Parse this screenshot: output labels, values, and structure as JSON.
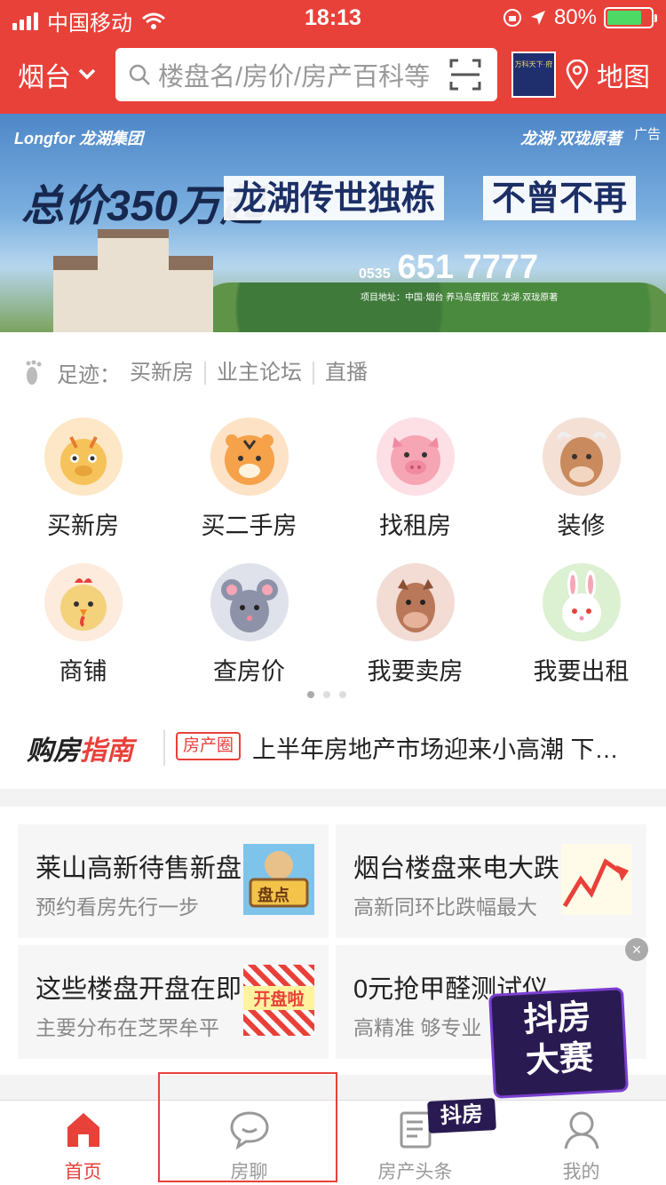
{
  "status_bar": {
    "carrier": "中国移动",
    "time": "18:13",
    "battery": "80%",
    "battery_level": 0.8
  },
  "header": {
    "city": "烟台",
    "search_placeholder": "楼盘名/房价/房产百科等",
    "map_label": "地图",
    "ad_thumb_text": "万科天下·府"
  },
  "banner": {
    "ad_tag": "广告",
    "brand_left": "Longfor 龙湖集团",
    "brand_right": "龙湖·双珑原著",
    "price": "总价350万起",
    "slogan1": "龙湖传世独栋",
    "slogan2": "不曾不再",
    "phone_prefix": "0535",
    "phone": "651 7777",
    "address": "项目地址：中国·烟台 养马岛度假区 龙湖·双珑原著"
  },
  "footprint": {
    "label": "足迹：",
    "items": [
      "买新房",
      "业主论坛",
      "直播"
    ]
  },
  "grid": [
    {
      "label": "买新房",
      "icon": "dragon-icon",
      "color": "#f6c35a"
    },
    {
      "label": "买二手房",
      "icon": "tiger-icon",
      "color": "#f5a24a"
    },
    {
      "label": "找租房",
      "icon": "pig-icon",
      "color": "#f6a5b5"
    },
    {
      "label": "装修",
      "icon": "ox-icon",
      "color": "#c98a5e"
    },
    {
      "label": "商铺",
      "icon": "rooster-icon",
      "color": "#f4d27c"
    },
    {
      "label": "查房价",
      "icon": "rat-icon",
      "color": "#8e92a8"
    },
    {
      "label": "我要卖房",
      "icon": "horse-icon",
      "color": "#b9785a"
    },
    {
      "label": "我要出租",
      "icon": "rabbit-icon",
      "color": "#b9e4a4"
    }
  ],
  "guide": {
    "logo_a": "购房",
    "logo_b": "指南",
    "tag": "房产圈",
    "text": "上半年房地产市场迎来小高潮 下…"
  },
  "cards": [
    {
      "title": "莱山高新待售新盘",
      "sub": "预约看房先行一步",
      "img_text": "盘点"
    },
    {
      "title": "烟台楼盘来电大跌",
      "sub": "高新同环比跌幅最大",
      "img_text": ""
    },
    {
      "title": "这些楼盘开盘在即",
      "sub": "主要分布在芝罘牟平",
      "img_text": "开盘啦"
    },
    {
      "title": "0元抢甲醛测试仪",
      "sub": "高精准 够专业",
      "img_text": ""
    }
  ],
  "promo": {
    "line1": "抖房",
    "line2": "大赛",
    "close": "×"
  },
  "tabbar": {
    "tabs": [
      {
        "label": "首页",
        "icon": "home-icon"
      },
      {
        "label": "房聊",
        "icon": "chat-icon"
      },
      {
        "label": "房产头条",
        "icon": "news-icon"
      },
      {
        "label": "我的",
        "icon": "profile-icon"
      }
    ],
    "badge": "抖房"
  },
  "colors": {
    "accent": "#e8413a",
    "text": "#222222",
    "muted": "#888888"
  }
}
